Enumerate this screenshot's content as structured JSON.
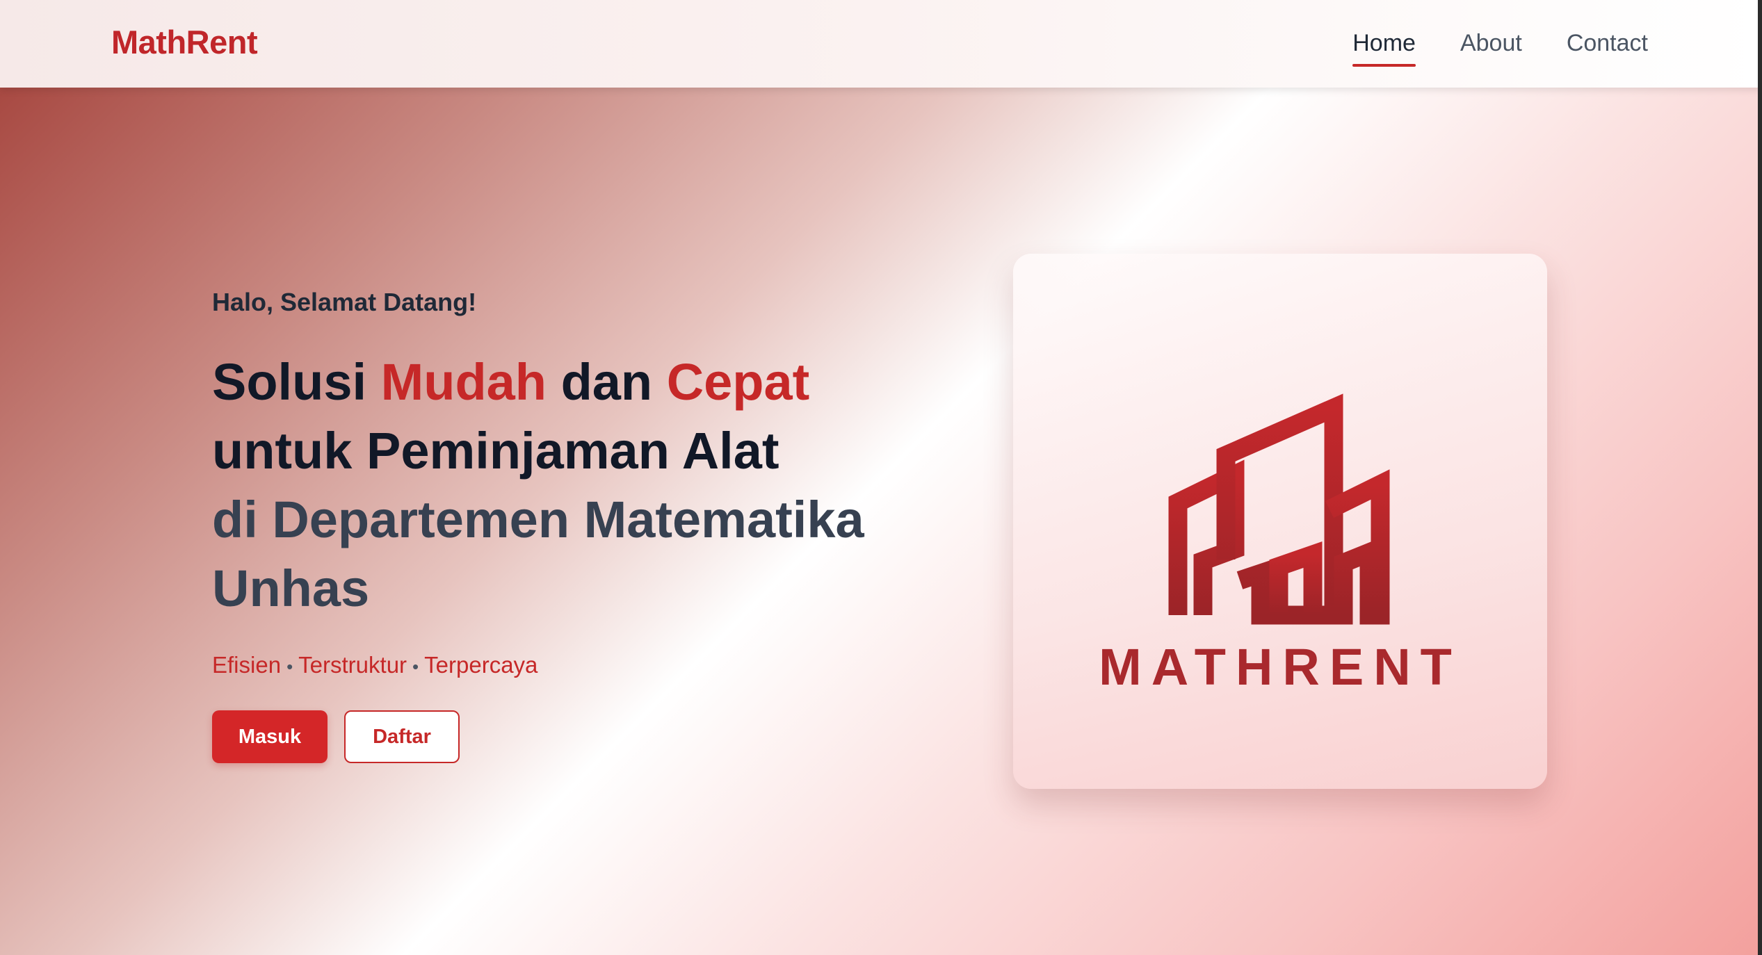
{
  "navbar": {
    "brand": "MathRent",
    "links": [
      {
        "label": "Home",
        "active": true
      },
      {
        "label": "About",
        "active": false
      },
      {
        "label": "Contact",
        "active": false
      }
    ]
  },
  "hero": {
    "greeting": "Halo, Selamat Datang!",
    "headline": {
      "solusi": "Solusi",
      "mudah": "Mudah",
      "dan": "dan",
      "cepat": "Cepat",
      "line2": "untuk Peminjaman Alat",
      "line3": "di Departemen Matematika",
      "line4": "Unhas"
    },
    "tagline": [
      "Efisien",
      "Terstruktur",
      "Terpercaya"
    ],
    "tagline_separator": "•",
    "buttons": {
      "login": "Masuk",
      "register": "Daftar"
    }
  },
  "logo_card": {
    "wordmark": "MATHRENT",
    "icon": "buildings-logo-icon"
  },
  "colors": {
    "brand_red": "#c62828",
    "primary_button": "#d42628",
    "heading_dark": "#111827",
    "heading_muted": "#374151"
  }
}
